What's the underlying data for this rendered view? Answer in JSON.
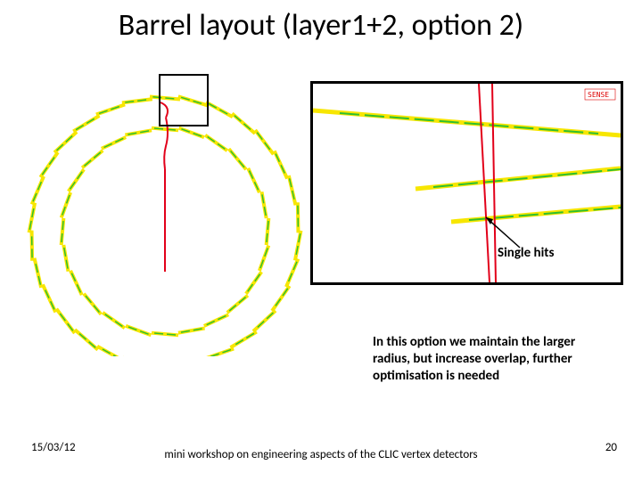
{
  "title": "Barrel layout (layer1+2, option 2)",
  "inset": {
    "single_hits_label": "Single hits",
    "badge": "SENSE"
  },
  "body_text": "In this option we maintain the larger radius, but increase overlap, further optimisation is needed",
  "footer": {
    "date": "15/03/12",
    "center": "mini workshop on engineering aspects of the CLIC vertex detectors",
    "page": "20"
  },
  "chart_data": {
    "type": "diagram",
    "description": "Cross-section of barrel vertex detector layers 1 and 2. Two concentric rings of sensor staves (yellow segments, green dashes) with a radial red track from the centre. Inset is a zoom of the top of the ring showing three staves crossed by a red double line, with an arrow annotating single hits.",
    "outer_ring": {
      "n_segments": 30,
      "radius_px": 150
    },
    "inner_ring": {
      "n_segments": 24,
      "radius_px": 115
    }
  }
}
